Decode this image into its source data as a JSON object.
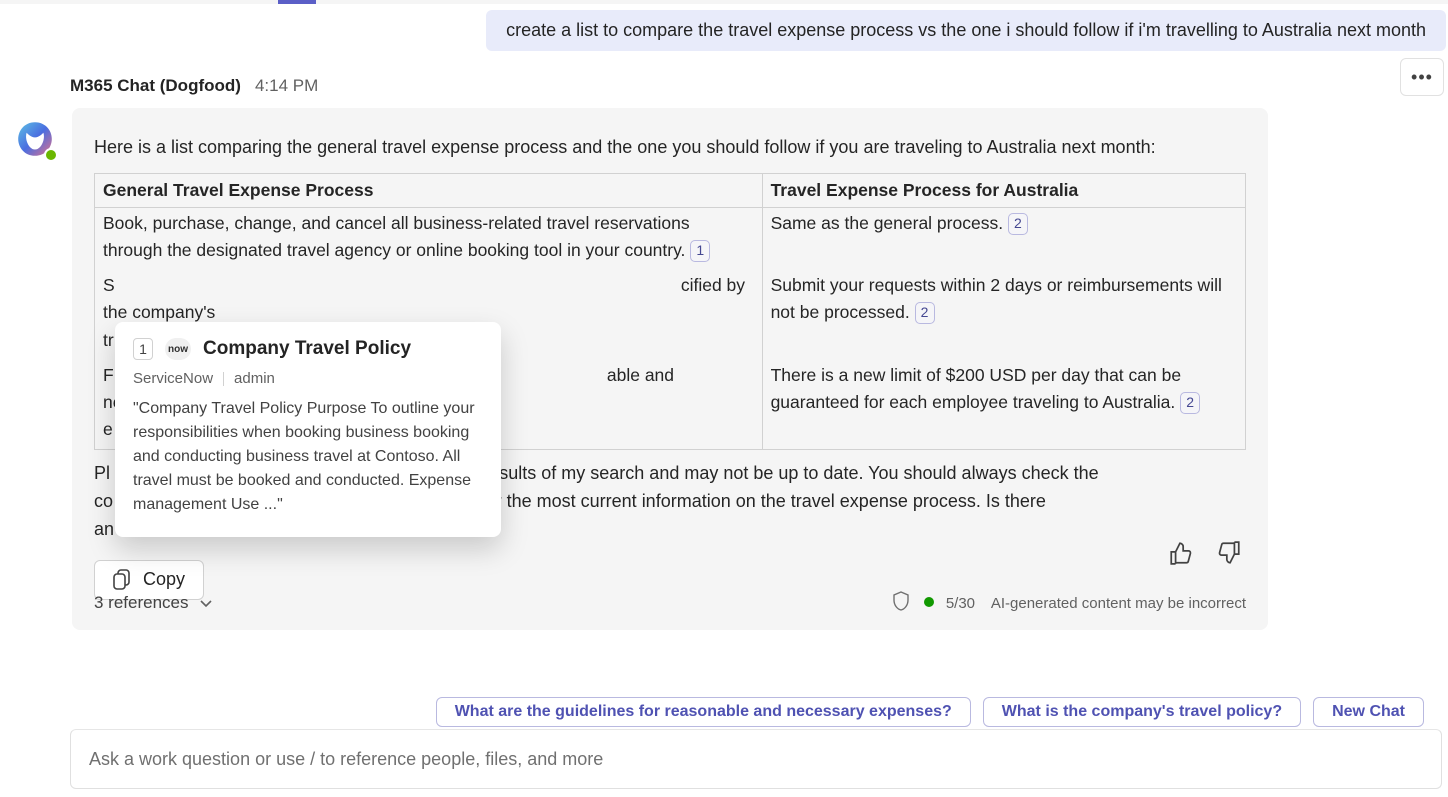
{
  "user_message": "create a list to compare the travel expense process vs the one i should follow if i'm travelling to Australia next month",
  "sender": {
    "name": "M365 Chat (Dogfood)",
    "time": "4:14 PM"
  },
  "intro": "Here is a list comparing the general travel expense process and the one you should follow if you are traveling to Australia next month:",
  "headers": {
    "general": "General Travel Expense Process",
    "australia": "Travel Expense Process for Australia"
  },
  "rows": {
    "r1": {
      "general": "Book, purchase, change, and cancel all business-related travel reservations through the designated travel agency or online booking tool in your country.",
      "australia": "Same as the general process."
    },
    "r2_general": {
      "prefix": "S",
      "suffix": "cified by the company's"
    },
    "r2_general_l2": "tr",
    "r2_australia": "Submit your requests within 2 days or reimbursements will not be processed.",
    "r3_general": {
      "prefix": "F",
      "suffix": "able and necessary"
    },
    "r3_general_l2": "e",
    "r3_australia": "There is a new limit of $200 USD per day that can be guaranteed for each employee traveling to Australia."
  },
  "cites": {
    "c1": "1",
    "c2": "2"
  },
  "footnote": {
    "prefix": "Pl",
    "mid1": "n the results of my search and may not be up to date. You should always check the",
    "prefix2": "co",
    "mid2": "tment for the most current information on the travel expense process. Is there",
    "prefix3": "an"
  },
  "copy_label": "Copy",
  "references": {
    "label": "3 references",
    "count_label": "5/30",
    "disclaimer": "AI-generated content may be incorrect"
  },
  "popover": {
    "number": "1",
    "logo_text": "now",
    "title": "Company Travel Policy",
    "source": "ServiceNow",
    "author": "admin",
    "body": "\"Company Travel Policy Purpose To outline your responsibilities when booking business booking and conducting business travel at Contoso. All travel must be booked and conducted. Expense management Use ...\""
  },
  "suggestions": {
    "s1": "What are the guidelines for reasonable and necessary expenses?",
    "s2": "What is the company's travel policy?",
    "s3": "New Chat"
  },
  "input_placeholder": "Ask a work question or use / to reference people, files, and more"
}
